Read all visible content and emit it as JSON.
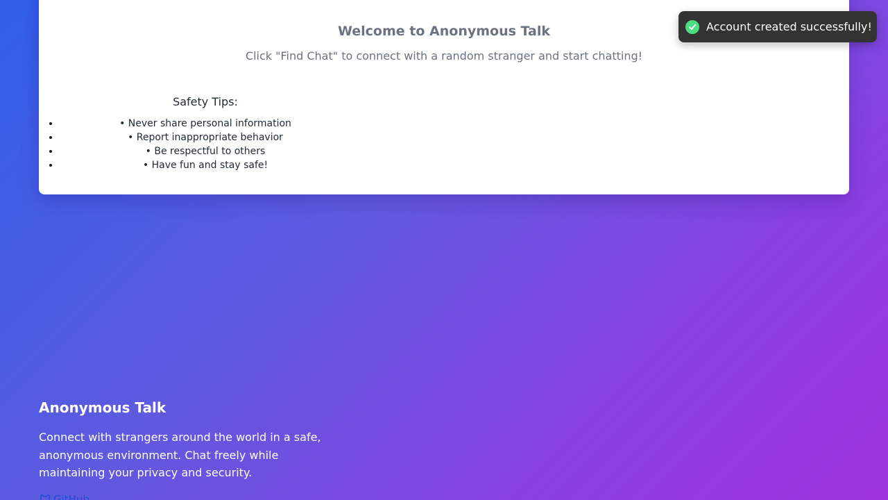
{
  "main": {
    "welcome_title": "Welcome to Anonymous Talk",
    "welcome_subtitle": "Click \"Find Chat\" to connect with a random stranger and start chatting!",
    "chat_icon": "chat-bubble-icon"
  },
  "safety": {
    "title": "Safety Tips:",
    "tips": [
      "• Never share personal information",
      "• Report inappropriate behavior",
      "• Be respectful to others",
      "• Have fun and stay safe!"
    ]
  },
  "toast": {
    "message": "Account created successfully!",
    "icon": "check-circle-icon",
    "icon_color": "#4ade80",
    "background": "#333333"
  },
  "footer": {
    "title": "Anonymous Talk",
    "description": "Connect with strangers around the world in a safe, anonymous environment. Chat freely while maintaining your privacy and security.",
    "github_label": "GitHub",
    "github_icon": "github-icon"
  },
  "colors": {
    "gradient_start": "#2f5fea",
    "gradient_end": "#a033dc",
    "link": "#1d4ed8"
  }
}
